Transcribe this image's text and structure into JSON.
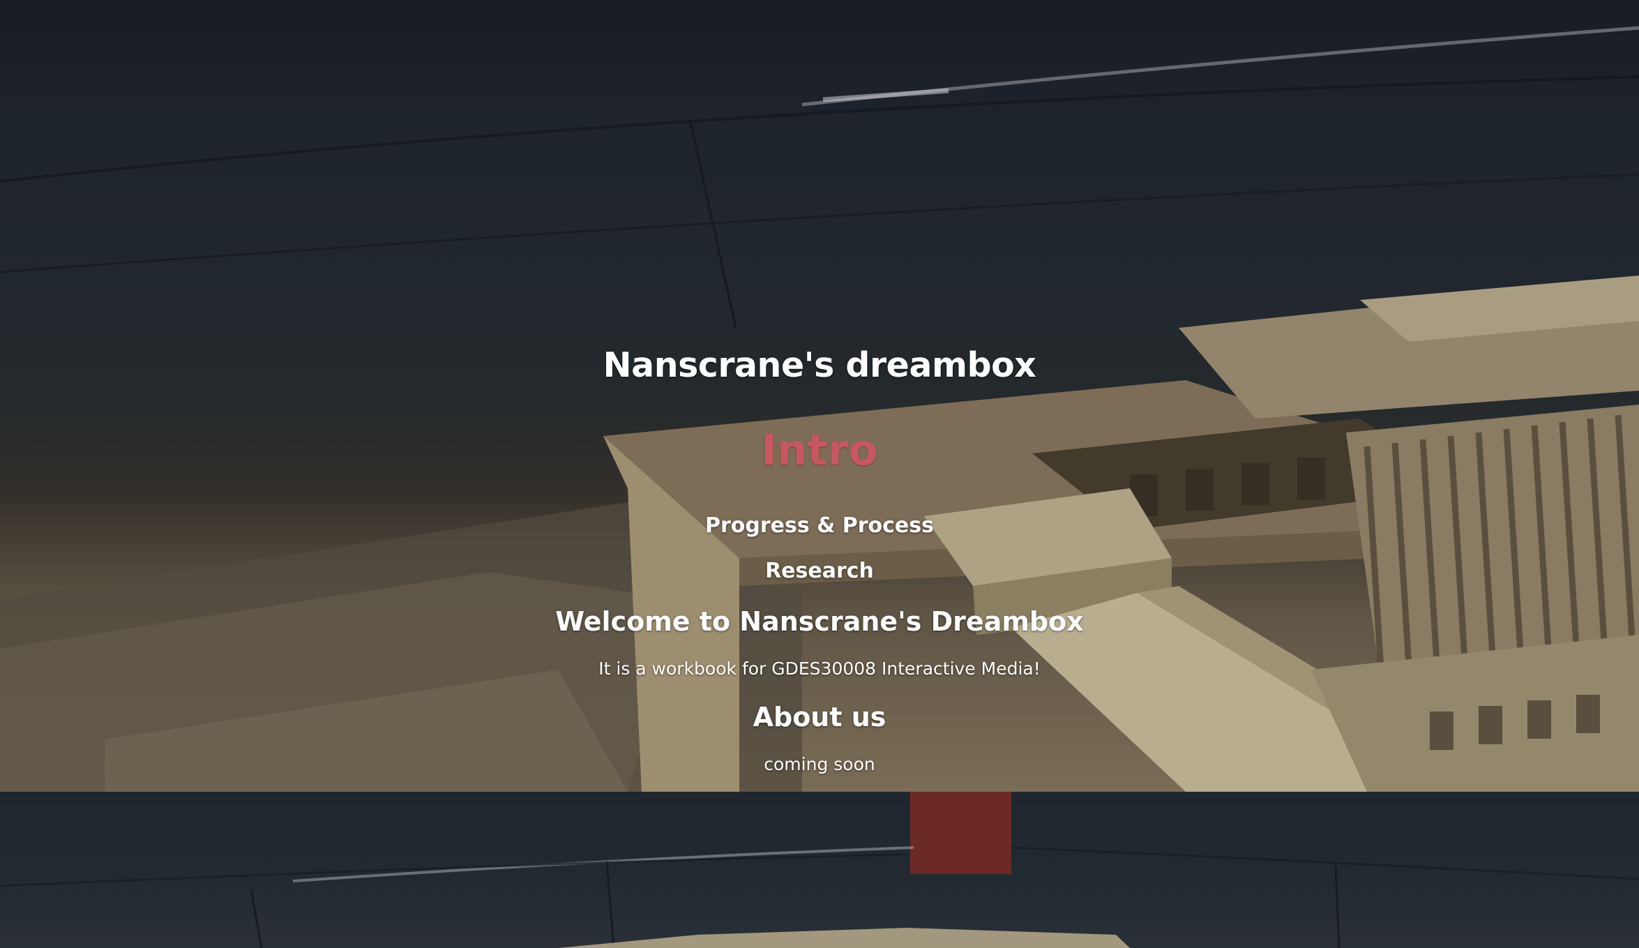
{
  "site": {
    "title": "Nanscrane's dreambox"
  },
  "nav": {
    "items": [
      {
        "label": "Intro",
        "active": true
      },
      {
        "label": "Progress & Process",
        "active": false
      },
      {
        "label": "Research",
        "active": false
      }
    ],
    "active_color": "#c8575f"
  },
  "welcome": {
    "heading": "Welcome to Nanscrane's Dreambox",
    "text": "It is a workbook for GDES30008 Interactive Media!"
  },
  "about": {
    "heading": "About us",
    "text": "coming soon"
  },
  "colors": {
    "text": "#ffffff",
    "background_dark": "#1f252b"
  }
}
